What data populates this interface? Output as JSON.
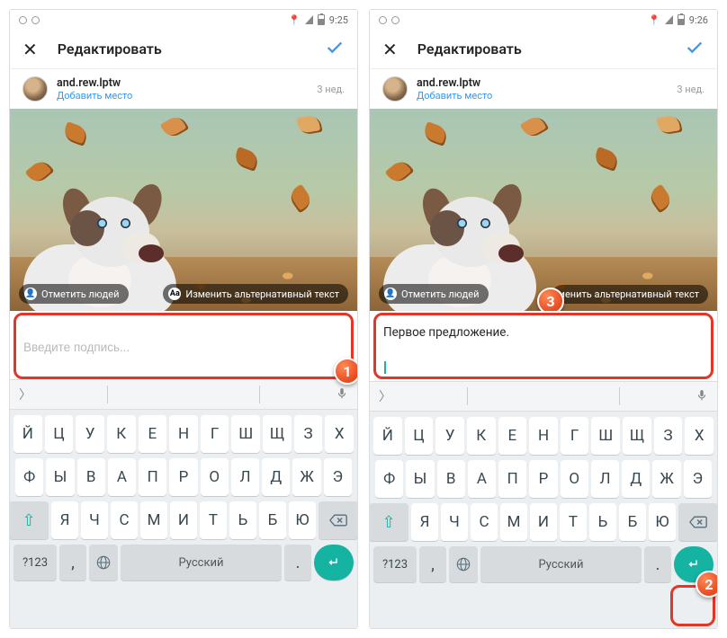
{
  "left": {
    "status_time": "9:25",
    "header_title": "Редактировать",
    "username": "and.rew.lptw",
    "add_place": "Добавить место",
    "time_ago": "3 нед.",
    "tag_people": "Отметить людей",
    "alt_text": "Изменить альтернативный текст",
    "caption_placeholder": "Введите подпись...",
    "caption_value": "",
    "badge": "1"
  },
  "right": {
    "status_time": "9:26",
    "header_title": "Редактировать",
    "username": "and.rew.lptw",
    "add_place": "Добавить место",
    "time_ago": "3 нед.",
    "tag_people": "Отметить людей",
    "alt_text": "менить альтернативный текст",
    "caption_value": "Первое предложение.",
    "badge_input": "3",
    "badge_enter": "2"
  },
  "keyboard": {
    "row1": [
      "Й",
      "Ц",
      "У",
      "К",
      "Е",
      "Н",
      "Г",
      "Ш",
      "Щ",
      "З",
      "Х"
    ],
    "row2": [
      "Ф",
      "Ы",
      "В",
      "А",
      "П",
      "Р",
      "О",
      "Л",
      "Д",
      "Ж",
      "Э"
    ],
    "row3": [
      "Я",
      "Ч",
      "С",
      "М",
      "И",
      "Т",
      "Ь",
      "Б",
      "Ю"
    ],
    "sym": "?123",
    "space": "Русский",
    "comma": ",",
    "dot": "."
  }
}
